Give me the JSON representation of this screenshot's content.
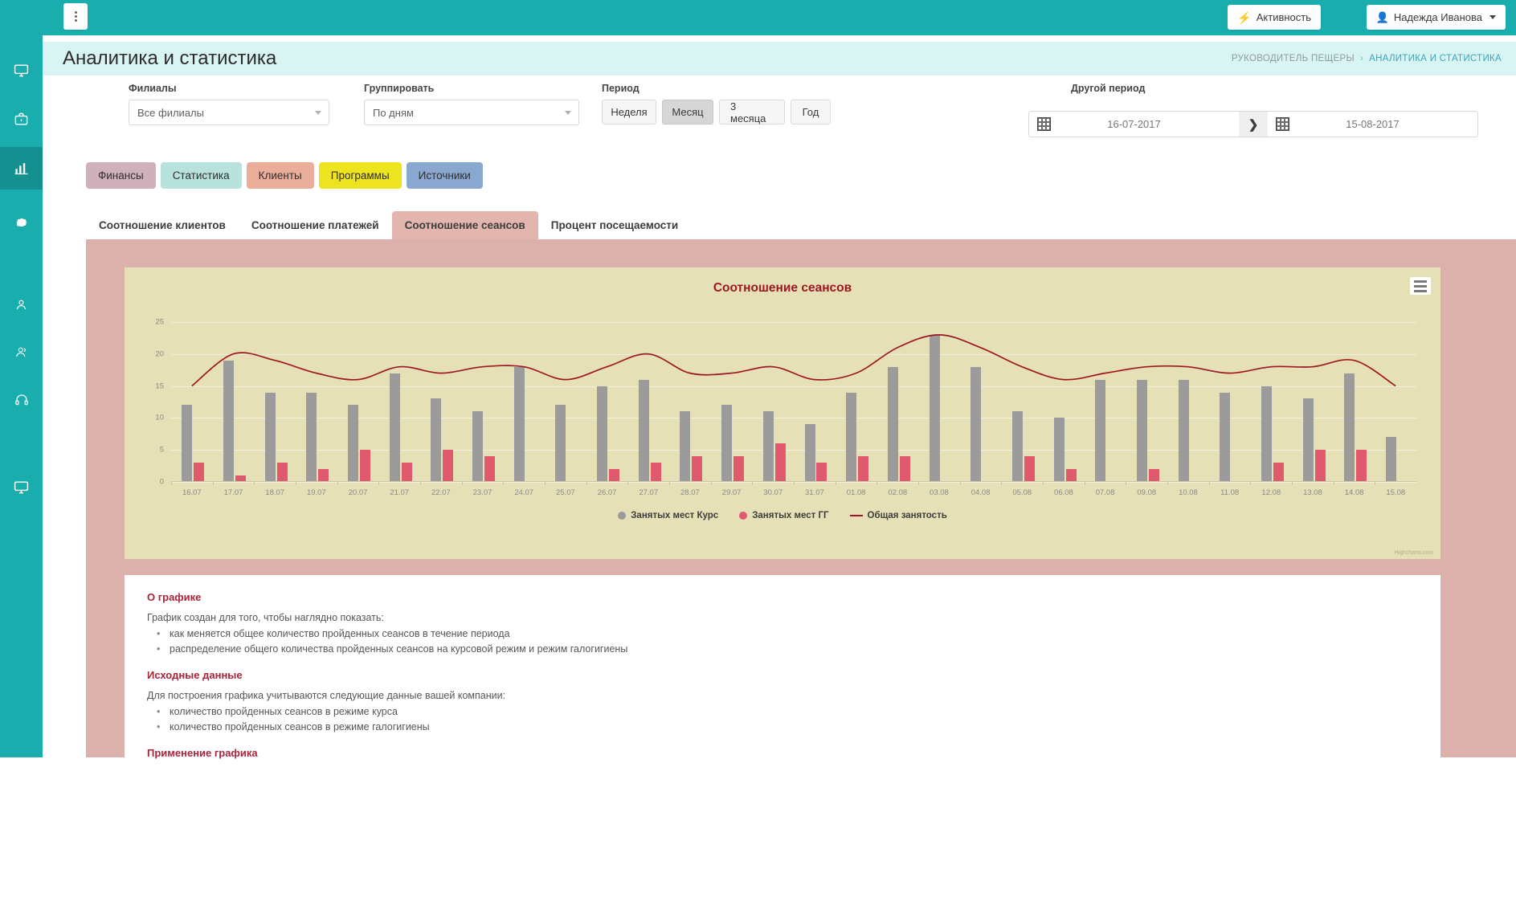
{
  "sidebar": {
    "items": [
      {
        "name": "monitor-icon",
        "label": "Монитор",
        "active": false
      },
      {
        "name": "briefcase-icon",
        "label": "Портфель",
        "active": false
      },
      {
        "name": "chart-bar-icon",
        "label": "Аналитика",
        "active": true
      },
      {
        "name": "gear-icon",
        "label": "Настройки",
        "active": false
      },
      {
        "name": "user-icon",
        "label": "Пользователь",
        "active": false
      },
      {
        "name": "users-icon",
        "label": "Клиенты",
        "active": false
      },
      {
        "name": "headset-icon",
        "label": "Поддержка",
        "active": false
      },
      {
        "name": "display-icon",
        "label": "Дисплей",
        "active": false
      }
    ]
  },
  "topbar": {
    "grip_label": "Меню",
    "activity_label": "Активность",
    "user_label": "Надежда Иванова"
  },
  "header": {
    "title": "Аналитика и статистика",
    "breadcrumb_root": "РУКОВОДИТЕЛЬ ПЕЩЕРЫ",
    "breadcrumb_sep": "›",
    "breadcrumb_current": "АНАЛИТИКА И СТАТИСТИКА"
  },
  "filters": {
    "branch_label": "Филиалы",
    "branch_value": "Все филиалы",
    "group_label": "Группировать",
    "group_value": "По дням",
    "period_label": "Период",
    "period_buttons": [
      {
        "label": "Неделя",
        "selected": false
      },
      {
        "label": "Месяц",
        "selected": true
      },
      {
        "label": "3 месяца",
        "selected": false
      },
      {
        "label": "Год",
        "selected": false
      }
    ],
    "other_period_label": "Другой период",
    "date_from": "16-07-2017",
    "date_to": "15-08-2017",
    "date_arrow": "❯"
  },
  "categories": [
    {
      "label": "Финансы",
      "color": "#cfb0bb"
    },
    {
      "label": "Статистика",
      "color": "#b8e2dc"
    },
    {
      "label": "Клиенты",
      "color": "#e9ad9a"
    },
    {
      "label": "Программы",
      "color": "#ede41f"
    },
    {
      "label": "Источники",
      "color": "#8aa7d0"
    }
  ],
  "tabs": [
    {
      "label": "Соотношение клиентов",
      "active": false
    },
    {
      "label": "Соотношение платежей",
      "active": false
    },
    {
      "label": "Соотношение сеансов",
      "active": true
    },
    {
      "label": "Процент посещаемости",
      "active": false
    }
  ],
  "chart_panel": {
    "menu_icon": "hamburger-icon",
    "credits": "Highcharts.com"
  },
  "info": {
    "blocks": [
      {
        "heading": "О графике",
        "paragraph": "График создан для того, чтобы наглядно показать:",
        "items": [
          "как меняется общее количество пройденных сеансов в течение периода",
          "распределение общего количества пройденных сеансов на курсовой режим и режим галогигиены"
        ]
      },
      {
        "heading": "Исходные данные",
        "paragraph": "Для построения графика учитываются следующие данные вашей компании:",
        "items": [
          "количество пройденных сеансов в режиме курса",
          "количество пройденных сеансов в режиме галогигиены"
        ]
      },
      {
        "heading": "Применение графика",
        "paragraph": "",
        "items": []
      }
    ]
  },
  "chart_data": {
    "type": "bar",
    "title": "Соотношение сеансов",
    "xlabel": "",
    "ylabel": "",
    "ylim": [
      0,
      27
    ],
    "yticks": [
      0,
      5,
      10,
      15,
      20,
      25
    ],
    "grid": true,
    "legend_position": "bottom",
    "colors": {
      "bar_course": "#9b9b9b",
      "bar_gg": "#e05a6e",
      "line_total": "#9e1824",
      "plot_background": "#e5e0b6",
      "panel_background": "#dcb0ab"
    },
    "categories": [
      "16.07",
      "17.07",
      "18.07",
      "19.07",
      "20.07",
      "21.07",
      "22.07",
      "23.07",
      "24.07",
      "25.07",
      "26.07",
      "27.07",
      "28.07",
      "29.07",
      "30.07",
      "31.07",
      "01.08",
      "02.08",
      "03.08",
      "04.08",
      "05.08",
      "06.08",
      "07.08",
      "09.08",
      "10.08",
      "11.08",
      "12.08",
      "13.08",
      "14.08",
      "15.08"
    ],
    "series": [
      {
        "name": "Занятых мест Курс",
        "type": "column",
        "color": "#9b9b9b",
        "values": [
          12,
          19,
          14,
          14,
          12,
          17,
          13,
          11,
          18,
          12,
          15,
          16,
          11,
          12,
          11,
          9,
          14,
          18,
          23,
          18,
          11,
          10,
          16,
          16,
          16,
          14,
          15,
          13,
          17,
          7
        ]
      },
      {
        "name": "Занятых мест ГГ",
        "type": "column",
        "color": "#e05a6e",
        "values": [
          3,
          1,
          3,
          2,
          5,
          3,
          5,
          4,
          0,
          0,
          2,
          3,
          4,
          4,
          6,
          3,
          4,
          4,
          0,
          0,
          4,
          2,
          0,
          2,
          0,
          0,
          3,
          5,
          5,
          0
        ]
      },
      {
        "name": "Общая занятость",
        "type": "spline",
        "color": "#9e1824",
        "values": [
          15,
          20,
          19,
          17,
          16,
          18,
          17,
          18,
          18,
          16,
          18,
          20,
          17,
          17,
          18,
          16,
          17,
          21,
          23,
          21,
          18,
          16,
          17,
          18,
          18,
          17,
          18,
          18,
          19,
          15
        ]
      }
    ]
  }
}
